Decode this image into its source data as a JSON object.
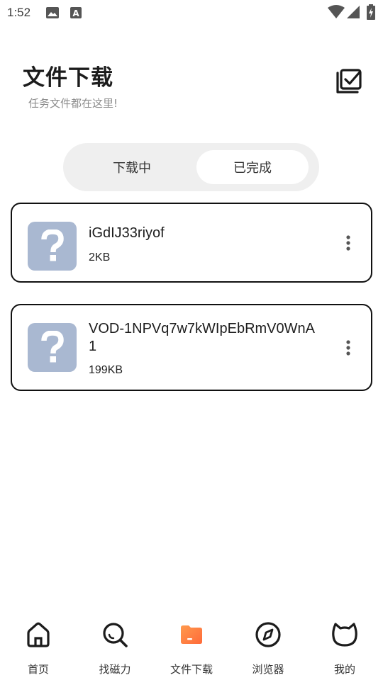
{
  "status_bar": {
    "time": "1:52",
    "icons": [
      "image-icon",
      "text-a-icon",
      "wifi-icon",
      "signal-icon",
      "battery-charging-icon"
    ]
  },
  "header": {
    "title": "文件下载",
    "subtitle": "任务文件都在这里!",
    "action_icon": "multi-select-check-icon"
  },
  "tabs": [
    {
      "label": "下载中",
      "selected": false
    },
    {
      "label": "已完成",
      "selected": true
    }
  ],
  "files": [
    {
      "name": "iGdIJ33riyof",
      "size": "2KB",
      "icon": "unknown-file-icon"
    },
    {
      "name": "VOD-1NPVq7w7kWIpEbRmV0WnA1",
      "size": "199KB",
      "icon": "unknown-file-icon"
    }
  ],
  "bottom_nav": [
    {
      "label": "首页",
      "icon": "home-icon",
      "active": false
    },
    {
      "label": "找磁力",
      "icon": "search-icon",
      "active": false
    },
    {
      "label": "文件下载",
      "icon": "folder-icon",
      "active": true
    },
    {
      "label": "浏览器",
      "icon": "compass-icon",
      "active": false
    },
    {
      "label": "我的",
      "icon": "cat-face-icon",
      "active": false
    }
  ],
  "colors": {
    "accent": "#ff7a3d",
    "thumb": "#a9b8d1",
    "tab_track": "#efefef"
  }
}
